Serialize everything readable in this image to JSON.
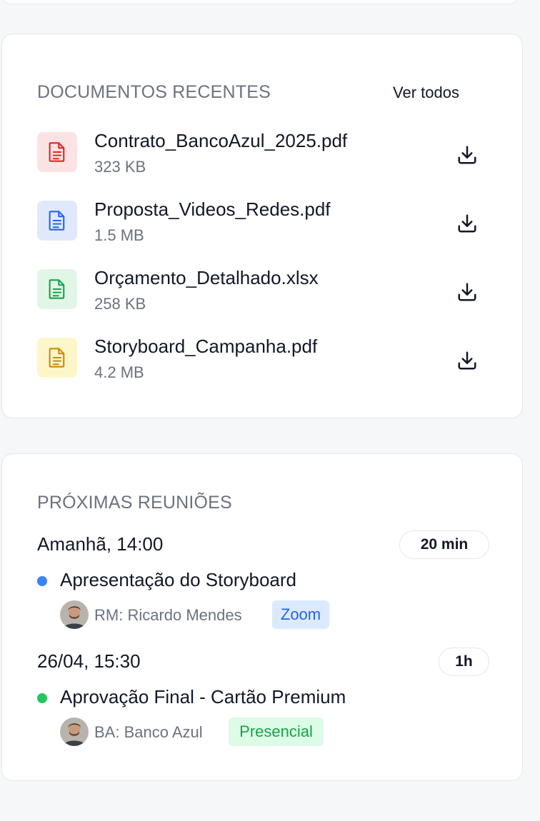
{
  "documents": {
    "title": "DOCUMENTOS RECENTES",
    "see_all": "Ver todos",
    "items": [
      {
        "name": "Contrato_BancoAzul_2025.pdf",
        "size": "323 KB",
        "icon": "file-text-icon",
        "color": "#dc2626",
        "bg": "#fbe3e4"
      },
      {
        "name": "Proposta_Videos_Redes.pdf",
        "size": "1.5 MB",
        "icon": "file-text-icon",
        "color": "#2563eb",
        "bg": "#e0e9fb"
      },
      {
        "name": "Orçamento_Detalhado.xlsx",
        "size": "258 KB",
        "icon": "file-text-icon",
        "color": "#16a34a",
        "bg": "#e2f6e7"
      },
      {
        "name": "Storyboard_Campanha.pdf",
        "size": "4.2 MB",
        "icon": "file-text-icon",
        "color": "#ca8a04",
        "bg": "#fdf6c9"
      }
    ]
  },
  "meetings": {
    "title": "PRÓXIMAS REUNIÕES",
    "items": [
      {
        "time": "Amanhã, 14:00",
        "duration": "20 min",
        "title": "Apresentação do Storyboard",
        "dot_color": "#3b82f6",
        "person": "RM: Ricardo Mendes",
        "tag": "Zoom",
        "tag_color": "#2563eb",
        "tag_bg": "#dbeafe"
      },
      {
        "time": "26/04, 15:30",
        "duration": "1h",
        "title": "Aprovação Final - Cartão Premium",
        "dot_color": "#22c55e",
        "person": "BA: Banco Azul",
        "tag": "Presencial",
        "tag_color": "#16a34a",
        "tag_bg": "#dcfce7"
      }
    ]
  }
}
